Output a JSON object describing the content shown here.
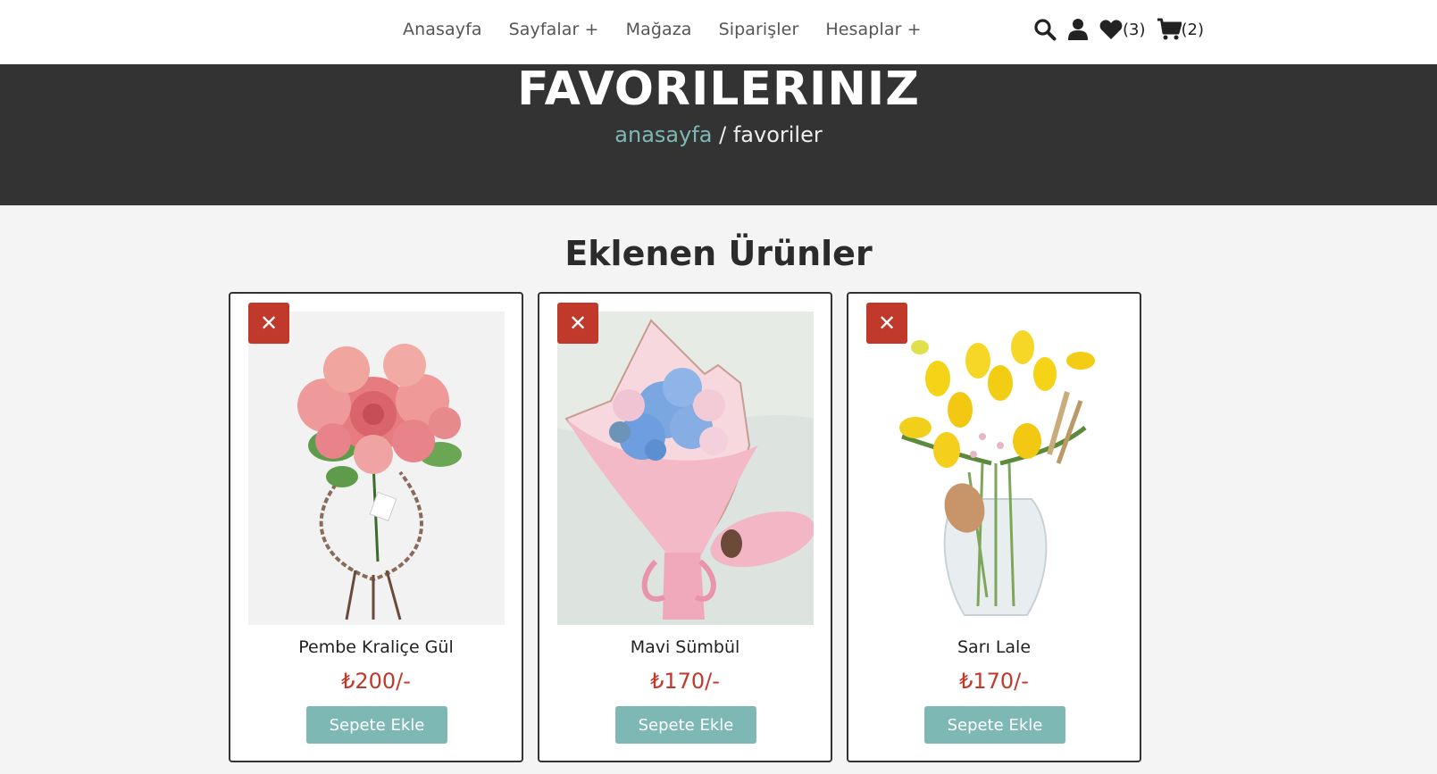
{
  "nav": {
    "items": [
      {
        "label": "Anasayfa"
      },
      {
        "label": "Sayfalar +"
      },
      {
        "label": "Mağaza"
      },
      {
        "label": "Siparişler"
      },
      {
        "label": "Hesaplar +"
      }
    ]
  },
  "header_icons": {
    "search": "search-icon",
    "user": "user-icon",
    "favorites_count": "(3)",
    "cart_count": "(2)"
  },
  "banner": {
    "title": "FAVORILERINIZ",
    "breadcrumb_home": "anasayfa",
    "breadcrumb_separator": " / ",
    "breadcrumb_current": "favoriler"
  },
  "section": {
    "title": "Eklenen Ürünler"
  },
  "products": [
    {
      "name": "Pembe Kraliçe Gül",
      "price": "₺200/-",
      "button": "Sepete Ekle",
      "remove": "✕"
    },
    {
      "name": "Mavi Sümbül",
      "price": "₺170/-",
      "button": "Sepete Ekle",
      "remove": "✕"
    },
    {
      "name": "Sarı Lale",
      "price": "₺170/-",
      "button": "Sepete Ekle",
      "remove": "✕"
    }
  ],
  "colors": {
    "accent": "#7db8b4",
    "danger": "#c0392b",
    "banner_bg": "#333333"
  }
}
